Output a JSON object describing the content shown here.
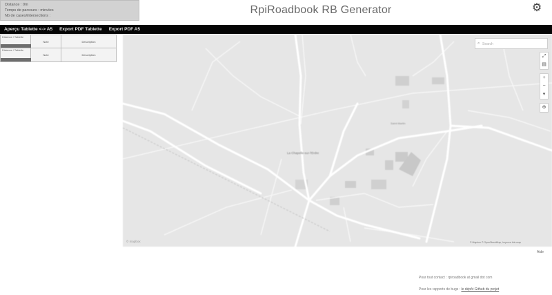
{
  "stats": {
    "distance": "Distance : 0m",
    "time": "Temps de parcours : minutes",
    "count": "Nb de cases/intersections :"
  },
  "app": {
    "title": "RpiRoadbook RB Generator"
  },
  "icons": {
    "settings": "gear-icon",
    "search": "search-icon"
  },
  "nav": {
    "items": [
      "Aperçu Tablette <-> A5",
      "Export PDF Tablette",
      "Export PDF A5"
    ]
  },
  "sidebar": {
    "rows": [
      {
        "label": "Distance / Tablette",
        "col2": "Note",
        "col3": "Description"
      },
      {
        "label": "Distance / Tablette",
        "col2": "Note",
        "col3": "Description"
      }
    ]
  },
  "map": {
    "search_placeholder": "Search",
    "controls": [
      "⤢",
      "▤",
      "+",
      "−",
      "▾",
      "⊕"
    ],
    "place_labels": [
      "La Chapelle-sur-l'Erdre",
      "Saint-Martin"
    ],
    "attribution": "© Mapbox © OpenStreetMap, Improve this map",
    "logo": "© mapbox"
  },
  "footer": {
    "aide": "Aide",
    "contact": "Pour tout contact : rpiroadbook at gmail dot com",
    "bugs_prefix": "Pour les rapports de bugs :",
    "bugs_link": "le dépôt Github du projet"
  },
  "colors": {
    "navbar": "#050505",
    "stats_bg": "#d2d2d2",
    "map_bg": "#e6e6e6",
    "road": "#ffffff"
  }
}
